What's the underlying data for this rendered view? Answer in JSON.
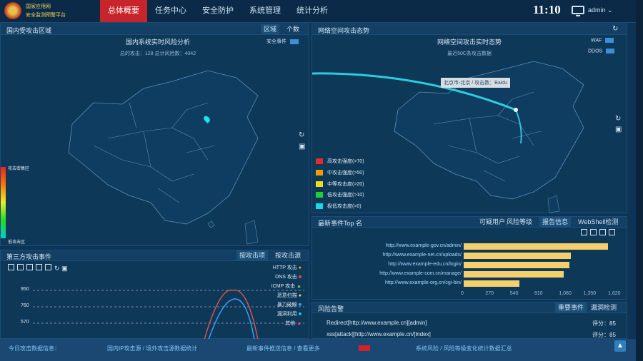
{
  "header": {
    "logo_line1": "国家应用网",
    "logo_line2": "安全监测预警平台",
    "nav": [
      "总体概要",
      "任务中心",
      "安全防护",
      "系统管理",
      "统计分析"
    ],
    "clock": "11:10",
    "user": "admin ⌄"
  },
  "left_map": {
    "title": "国内受攻击区域",
    "tabs": [
      "区域",
      "个数"
    ],
    "chart_title": "国内系统实时风险分析",
    "subtitle": "总的攻击：128  总计风险数：4042",
    "legend": "安全事件",
    "scale_high": "攻击密集区",
    "scale_low": "低攻击区"
  },
  "right_map": {
    "title": "网络空间攻击态势",
    "chart_title": "网络空间攻击实时态势",
    "subtitle": "最近50C条攻击数据",
    "legend": [
      "WAF",
      "DDOS"
    ],
    "tooltip": "北京市-北京 / 攻击数：Baidu",
    "levels": [
      {
        "label": "高攻击强度(>70)",
        "color": "#e22b2b"
      },
      {
        "label": "中攻击强度(>50)",
        "color": "#f59a0b"
      },
      {
        "label": "中等攻击度(>20)",
        "color": "#eedc23"
      },
      {
        "label": "低攻击强度(>10)",
        "color": "#21cf3a"
      },
      {
        "label": "极低攻击度(>0)",
        "color": "#19d7e6"
      }
    ]
  },
  "events_panel": {
    "title": "第三方攻击事件",
    "tabs": [
      "按攻击项",
      "按攻击源"
    ],
    "yticks": [
      "950",
      "760",
      "570"
    ],
    "legend": [
      "HTTP 攻击",
      "DNS 攻击",
      "ICMP 攻击",
      "恶意扫描",
      "暴力破解",
      "漏洞利用",
      "其他"
    ]
  },
  "top_panel": {
    "title": "最新事件Top 名",
    "tabs": [
      "可疑用户",
      "风险等级",
      "报告信息",
      "WebShell检测"
    ],
    "xticks": [
      "0",
      "270",
      "540",
      "810",
      "1,080",
      "1,350",
      "1,620"
    ],
    "bars": [
      {
        "label": "http://www.example-gov.cn/admin/",
        "value": 1590
      },
      {
        "label": "http://www.example-net.cn/uploads/",
        "value": 1180
      },
      {
        "label": "http://www.example-edu.cn/login/",
        "value": 1160
      },
      {
        "label": "http://www.example-com.cn/manage/",
        "value": 1100
      },
      {
        "label": "http://www.example-org.cn/cgi-bin/",
        "value": 610
      }
    ]
  },
  "alerts_panel": {
    "title": "风险告警",
    "tabs": [
      "重要事件",
      "漏洞检测"
    ],
    "rows": [
      {
        "text": "Redirect[http://www.example.cn][admin]",
        "score": "评分：85"
      },
      {
        "text": "xss[attack][http://www.example.cn/[index]",
        "score": "评分：85"
      }
    ]
  },
  "footer": [
    "今日攻击数据信息：",
    "国内IP攻击源 / 境外攻击源数据统计",
    "最新事件推送信息 / 查看更多",
    "系统风险 / 风险等级变化统计数据汇总"
  ]
}
